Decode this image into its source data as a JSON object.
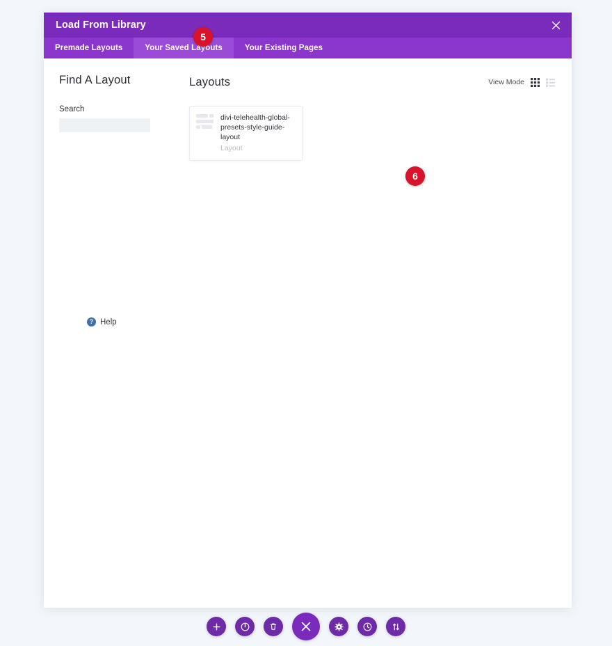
{
  "modal": {
    "title": "Load From Library",
    "close_icon": "close-icon",
    "tabs": [
      {
        "label": "Premade Layouts",
        "active": false
      },
      {
        "label": "Your Saved Layouts",
        "active": true
      },
      {
        "label": "Your Existing Pages",
        "active": false
      }
    ]
  },
  "badges": [
    {
      "id": "5",
      "value": "5",
      "color": "#d8132b"
    },
    {
      "id": "6",
      "value": "6",
      "color": "#d8132b"
    }
  ],
  "sidebar": {
    "title": "Find A Layout",
    "search": {
      "label": "Search",
      "value": "",
      "placeholder": ""
    },
    "help": {
      "icon": "question-mark-icon",
      "label": "Help"
    }
  },
  "main": {
    "title": "Layouts",
    "view_mode": {
      "label": "View Mode",
      "grid_icon": "grid-view-icon",
      "list_icon": "list-view-icon",
      "selected": "grid"
    },
    "layouts": [
      {
        "name": "divi-telehealth-global-presets-style-guide-layout",
        "type": "Layout"
      }
    ]
  },
  "toolbar": {
    "buttons": [
      {
        "name": "add-button",
        "icon": "plus-icon"
      },
      {
        "name": "power-button",
        "icon": "power-icon"
      },
      {
        "name": "trash-button",
        "icon": "trash-icon"
      },
      {
        "name": "close-builder-button",
        "icon": "close-x-icon"
      },
      {
        "name": "settings-button",
        "icon": "gear-icon"
      },
      {
        "name": "history-button",
        "icon": "clock-icon"
      },
      {
        "name": "responsive-button",
        "icon": "arrows-up-down-icon"
      }
    ]
  },
  "colors": {
    "header_purple": "#7b2bbb",
    "tabbar_purple": "#8a35cc",
    "active_tab_purple": "#9a4cd8",
    "badge_red": "#d8132b",
    "page_background": "#f3f7fb",
    "toolbar_purple": "#6e2ba8"
  }
}
